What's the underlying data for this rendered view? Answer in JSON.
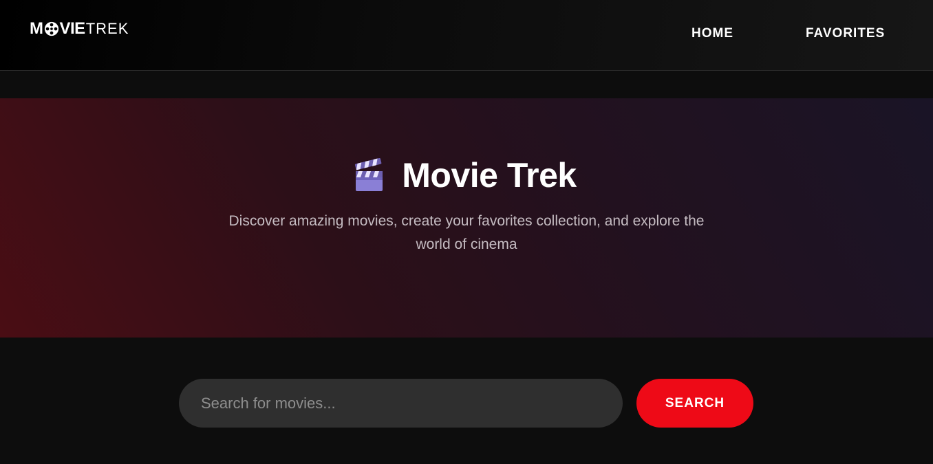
{
  "nav": {
    "logo_bold": "MOVIE",
    "logo_thin": "TREK",
    "logo_icon": "film-reel-icon",
    "links": [
      {
        "label": "HOME"
      },
      {
        "label": "FAVORITES"
      }
    ]
  },
  "hero": {
    "icon": "clapper-board-icon",
    "title": "Movie Trek",
    "subtitle": "Discover amazing movies, create your favorites collection, and explore the world of cinema"
  },
  "search": {
    "placeholder": "Search for movies...",
    "value": "",
    "button_label": "SEARCH"
  },
  "colors": {
    "accent": "#ee0a17",
    "background": "#0d0d0d",
    "input_bg": "#2f2f2f"
  }
}
